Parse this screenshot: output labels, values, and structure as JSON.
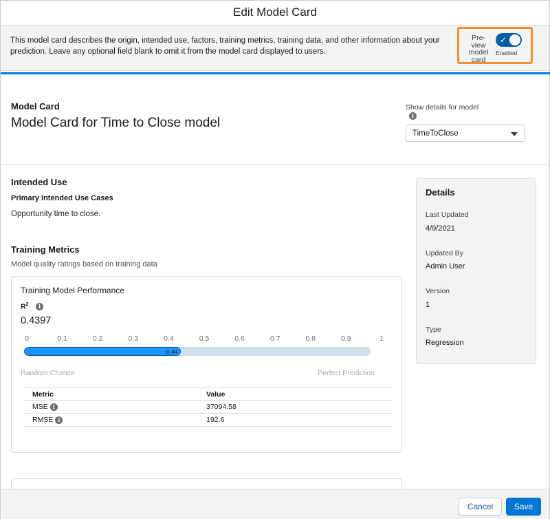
{
  "modal": {
    "title": "Edit Model Card",
    "intro": "This model card describes the origin, intended use, factors, training metrics, training data, and other information about your prediction. Leave any optional field blank to omit it from the model card displayed to users."
  },
  "preview_toggle": {
    "label": "Pre-view model card",
    "state_label": "Enabled",
    "enabled": true,
    "accent": "#0b5cab",
    "highlight_color": "#f0922b"
  },
  "model_card": {
    "heading": "Model Card",
    "title": "Model Card for Time to Close model",
    "show_details_label": "Show details for model",
    "selected_model": "TimeToClose"
  },
  "intended_use": {
    "heading": "Intended Use",
    "subheading": "Primary Intended Use Cases",
    "text": "Opportunity time to close."
  },
  "training_metrics": {
    "heading": "Training Metrics",
    "subheading": "Model quality ratings based on training data",
    "card_title": "Training Model Performance",
    "r2_label": "R",
    "r2_sup": "2",
    "r2_value": "0.4397",
    "scale_ticks": [
      "0",
      "0.1",
      "0.2",
      "0.3",
      "0.4",
      "0.5",
      "0.6",
      "0.7",
      "0.8",
      "0.9",
      "1"
    ],
    "bar_value": 0.44,
    "bar_label": "0.44",
    "left_end": "Random Chance",
    "right_end": "Perfect Prediction",
    "table": {
      "headers": [
        "Metric",
        "Value"
      ],
      "rows": [
        {
          "metric": "MSE",
          "value": "37094.58"
        },
        {
          "metric": "RMSE",
          "value": "192.6"
        }
      ]
    }
  },
  "details": {
    "title": "Details",
    "items": [
      {
        "label": "Last Updated",
        "value": "4/9/2021"
      },
      {
        "label": "Updated By",
        "value": "Admin User"
      },
      {
        "label": "Version",
        "value": "1"
      },
      {
        "label": "Type",
        "value": "Regression"
      }
    ]
  },
  "footer": {
    "cancel_label": "Cancel",
    "save_label": "Save"
  },
  "icons": {
    "info": "info-icon",
    "caret": "chevron-down-icon",
    "check": "check-icon"
  }
}
